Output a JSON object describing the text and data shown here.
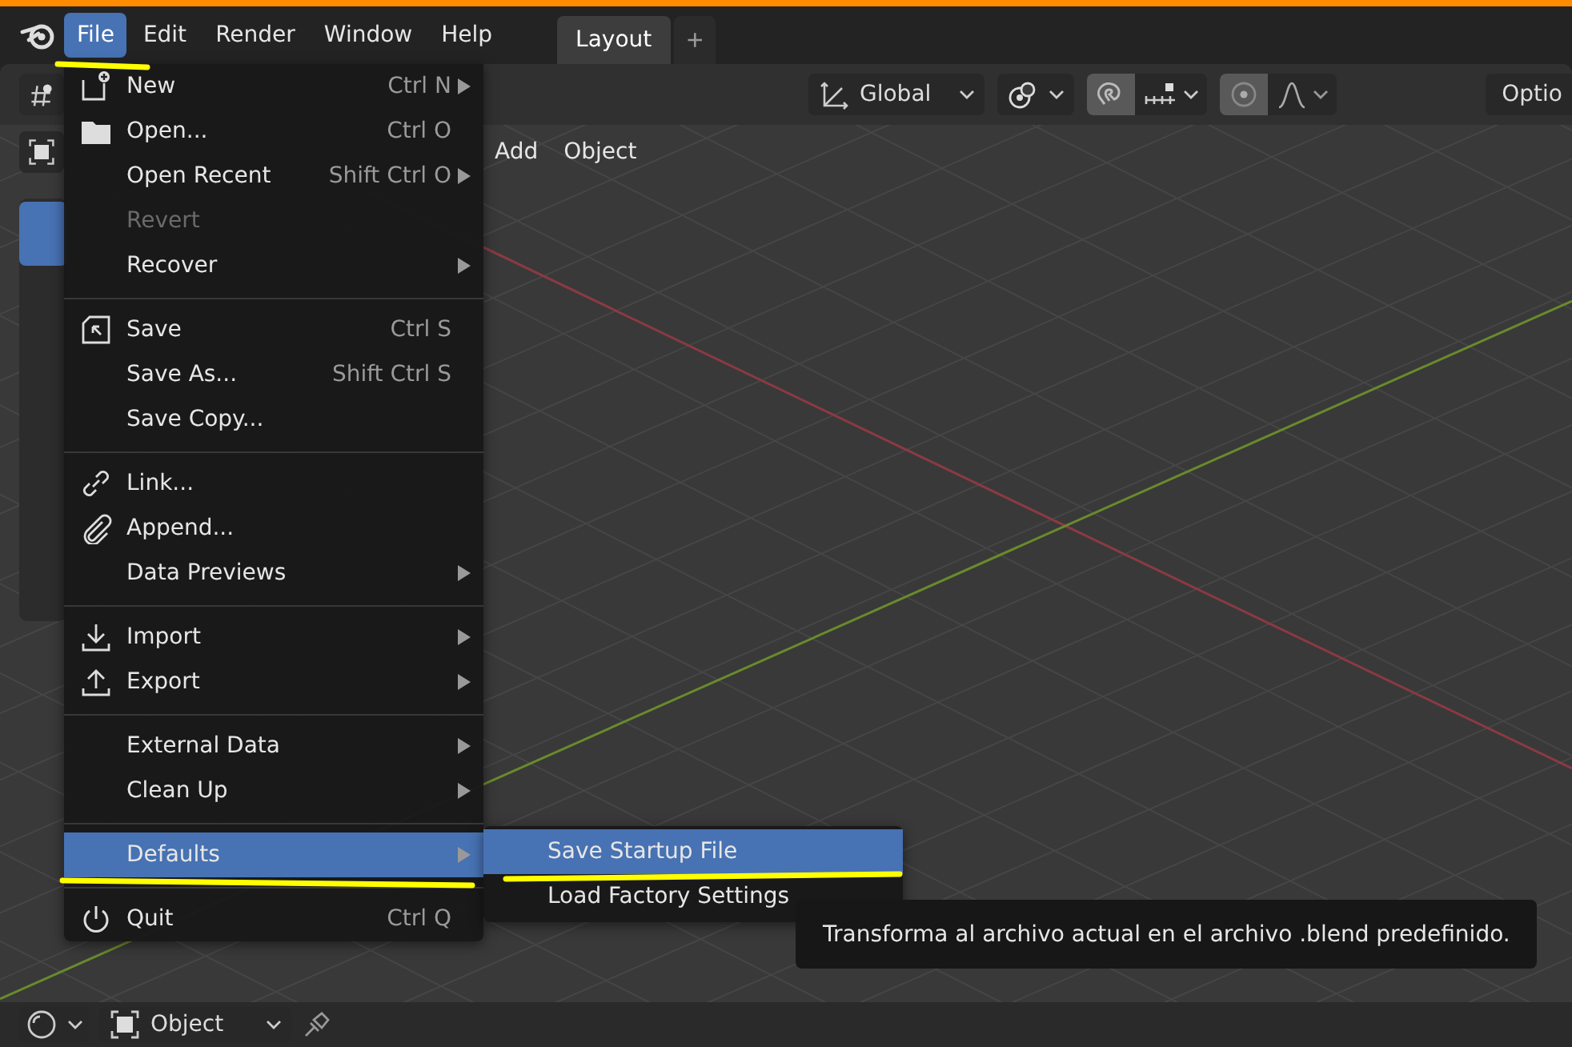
{
  "topbar": {
    "menus": [
      {
        "label": "File",
        "selected": true
      },
      {
        "label": "Edit",
        "selected": false
      },
      {
        "label": "Render",
        "selected": false
      },
      {
        "label": "Window",
        "selected": false
      },
      {
        "label": "Help",
        "selected": false
      }
    ],
    "workspace_tabs": [
      {
        "label": "Layout",
        "selected": true
      }
    ],
    "add_tab": "+"
  },
  "tool_settings": {
    "orientation": "Global",
    "options_label": "Optio"
  },
  "viewport_header": {
    "menus": [
      "Add",
      "Object"
    ]
  },
  "file_menu": {
    "sections": [
      [
        {
          "label": "New",
          "shortcut": "Ctrl N",
          "submenu": true,
          "disabled": false,
          "selected": false
        },
        {
          "label": "Open...",
          "shortcut": "Ctrl O",
          "submenu": false,
          "disabled": false,
          "selected": false
        },
        {
          "label": "Open Recent",
          "shortcut": "Shift Ctrl O",
          "submenu": true,
          "disabled": false,
          "selected": false
        },
        {
          "label": "Revert",
          "submenu": false,
          "disabled": true,
          "selected": false
        },
        {
          "label": "Recover",
          "submenu": true,
          "disabled": false,
          "selected": false
        }
      ],
      [
        {
          "label": "Save",
          "shortcut": "Ctrl S",
          "submenu": false,
          "disabled": false,
          "selected": false
        },
        {
          "label": "Save As...",
          "shortcut": "Shift Ctrl S",
          "submenu": false,
          "disabled": false,
          "selected": false
        },
        {
          "label": "Save Copy...",
          "submenu": false,
          "disabled": false,
          "selected": false
        }
      ],
      [
        {
          "label": "Link...",
          "submenu": false,
          "disabled": false,
          "selected": false
        },
        {
          "label": "Append...",
          "submenu": false,
          "disabled": false,
          "selected": false
        },
        {
          "label": "Data Previews",
          "submenu": true,
          "disabled": false,
          "selected": false
        }
      ],
      [
        {
          "label": "Import",
          "submenu": true,
          "disabled": false,
          "selected": false
        },
        {
          "label": "Export",
          "submenu": true,
          "disabled": false,
          "selected": false
        }
      ],
      [
        {
          "label": "External Data",
          "submenu": true,
          "disabled": false,
          "selected": false
        },
        {
          "label": "Clean Up",
          "submenu": true,
          "disabled": false,
          "selected": false
        }
      ],
      [
        {
          "label": "Defaults",
          "submenu": true,
          "disabled": false,
          "selected": true
        }
      ],
      [
        {
          "label": "Quit",
          "shortcut": "Ctrl Q",
          "submenu": false,
          "disabled": false,
          "selected": false
        }
      ]
    ]
  },
  "submenu": {
    "items": [
      {
        "label": "Save Startup File",
        "selected": true
      },
      {
        "label": "Load Factory Settings",
        "selected": false
      }
    ]
  },
  "tooltip": "Transforma al archivo actual en el archivo .blend predefinido.",
  "bottom_bar": {
    "mode": "Object"
  }
}
